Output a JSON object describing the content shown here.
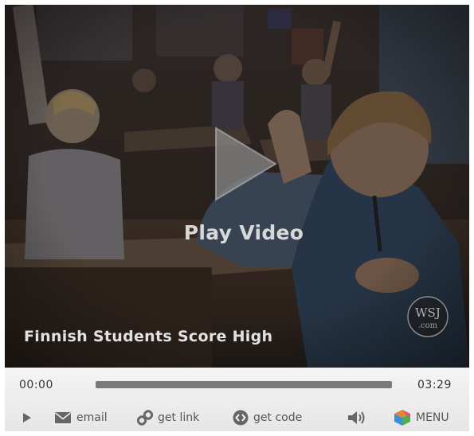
{
  "player": {
    "play_label": "Play Video",
    "title": "Finnish Students Score High",
    "watermark_text": "WSJ.com",
    "current_time": "00:00",
    "total_time": "03:29",
    "progress": 0
  },
  "toolbar": {
    "play_icon": "play-icon",
    "email_icon": "envelope-icon",
    "email_label": "email",
    "link_icon": "chain-link-icon",
    "link_label": "get link",
    "code_icon": "code-brackets-icon",
    "code_label": "get code",
    "volume_icon": "speaker-icon",
    "menu_icon": "menu-cube-icon",
    "menu_label": "MENU"
  },
  "colors": {
    "controls_bg": "#eeeeee",
    "progress_track": "#7a7a7a",
    "overlay_text": "#d8d8d8",
    "icon_gray": "#666666"
  }
}
